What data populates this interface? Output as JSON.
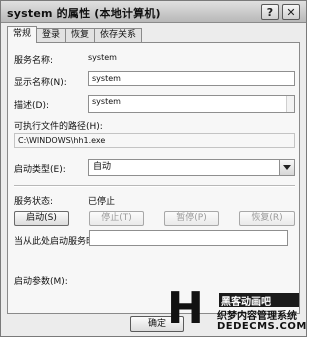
{
  "window": {
    "title": "system 的属性 (本地计算机)"
  },
  "titlebar": {
    "help_glyph": "?",
    "close_glyph": "✕"
  },
  "tabs": [
    {
      "label": "常规"
    },
    {
      "label": "登录"
    },
    {
      "label": "恢复"
    },
    {
      "label": "依存关系"
    }
  ],
  "general": {
    "service_name_label": "服务名称:",
    "service_name_value": "system",
    "display_name_label": "显示名称(N):",
    "display_name_value": "system",
    "description_label": "描述(D):",
    "description_value": "system",
    "exe_path_label": "可执行文件的路径(H):",
    "exe_path_value": "C:\\WINDOWS\\hh1.exe",
    "startup_type_label": "启动类型(E):",
    "startup_type_value": "自动",
    "status_label": "服务状态:",
    "status_value": "已停止",
    "start_button": "启动(S)",
    "stop_button": "停止(T)",
    "pause_button": "暂停(P)",
    "resume_button": "恢复(R)",
    "hint": "当从此处启动服务时，您可指定所适用的启动参数。",
    "params_label": "启动参数(M):"
  },
  "footer": {
    "ok_button": "确定"
  },
  "watermark": {
    "logo": "H",
    "line1": "黑客动画吧",
    "line2": "织梦内容管理系统",
    "line3": "DEDECMS.COM"
  },
  "icons": {
    "help": "help-icon",
    "close": "close-icon",
    "dropdown": "chevron-down-icon"
  },
  "colors": {
    "window_bg": "#ececec",
    "panel_bg": "#f7f7f7",
    "border": "#8a8a8a"
  }
}
